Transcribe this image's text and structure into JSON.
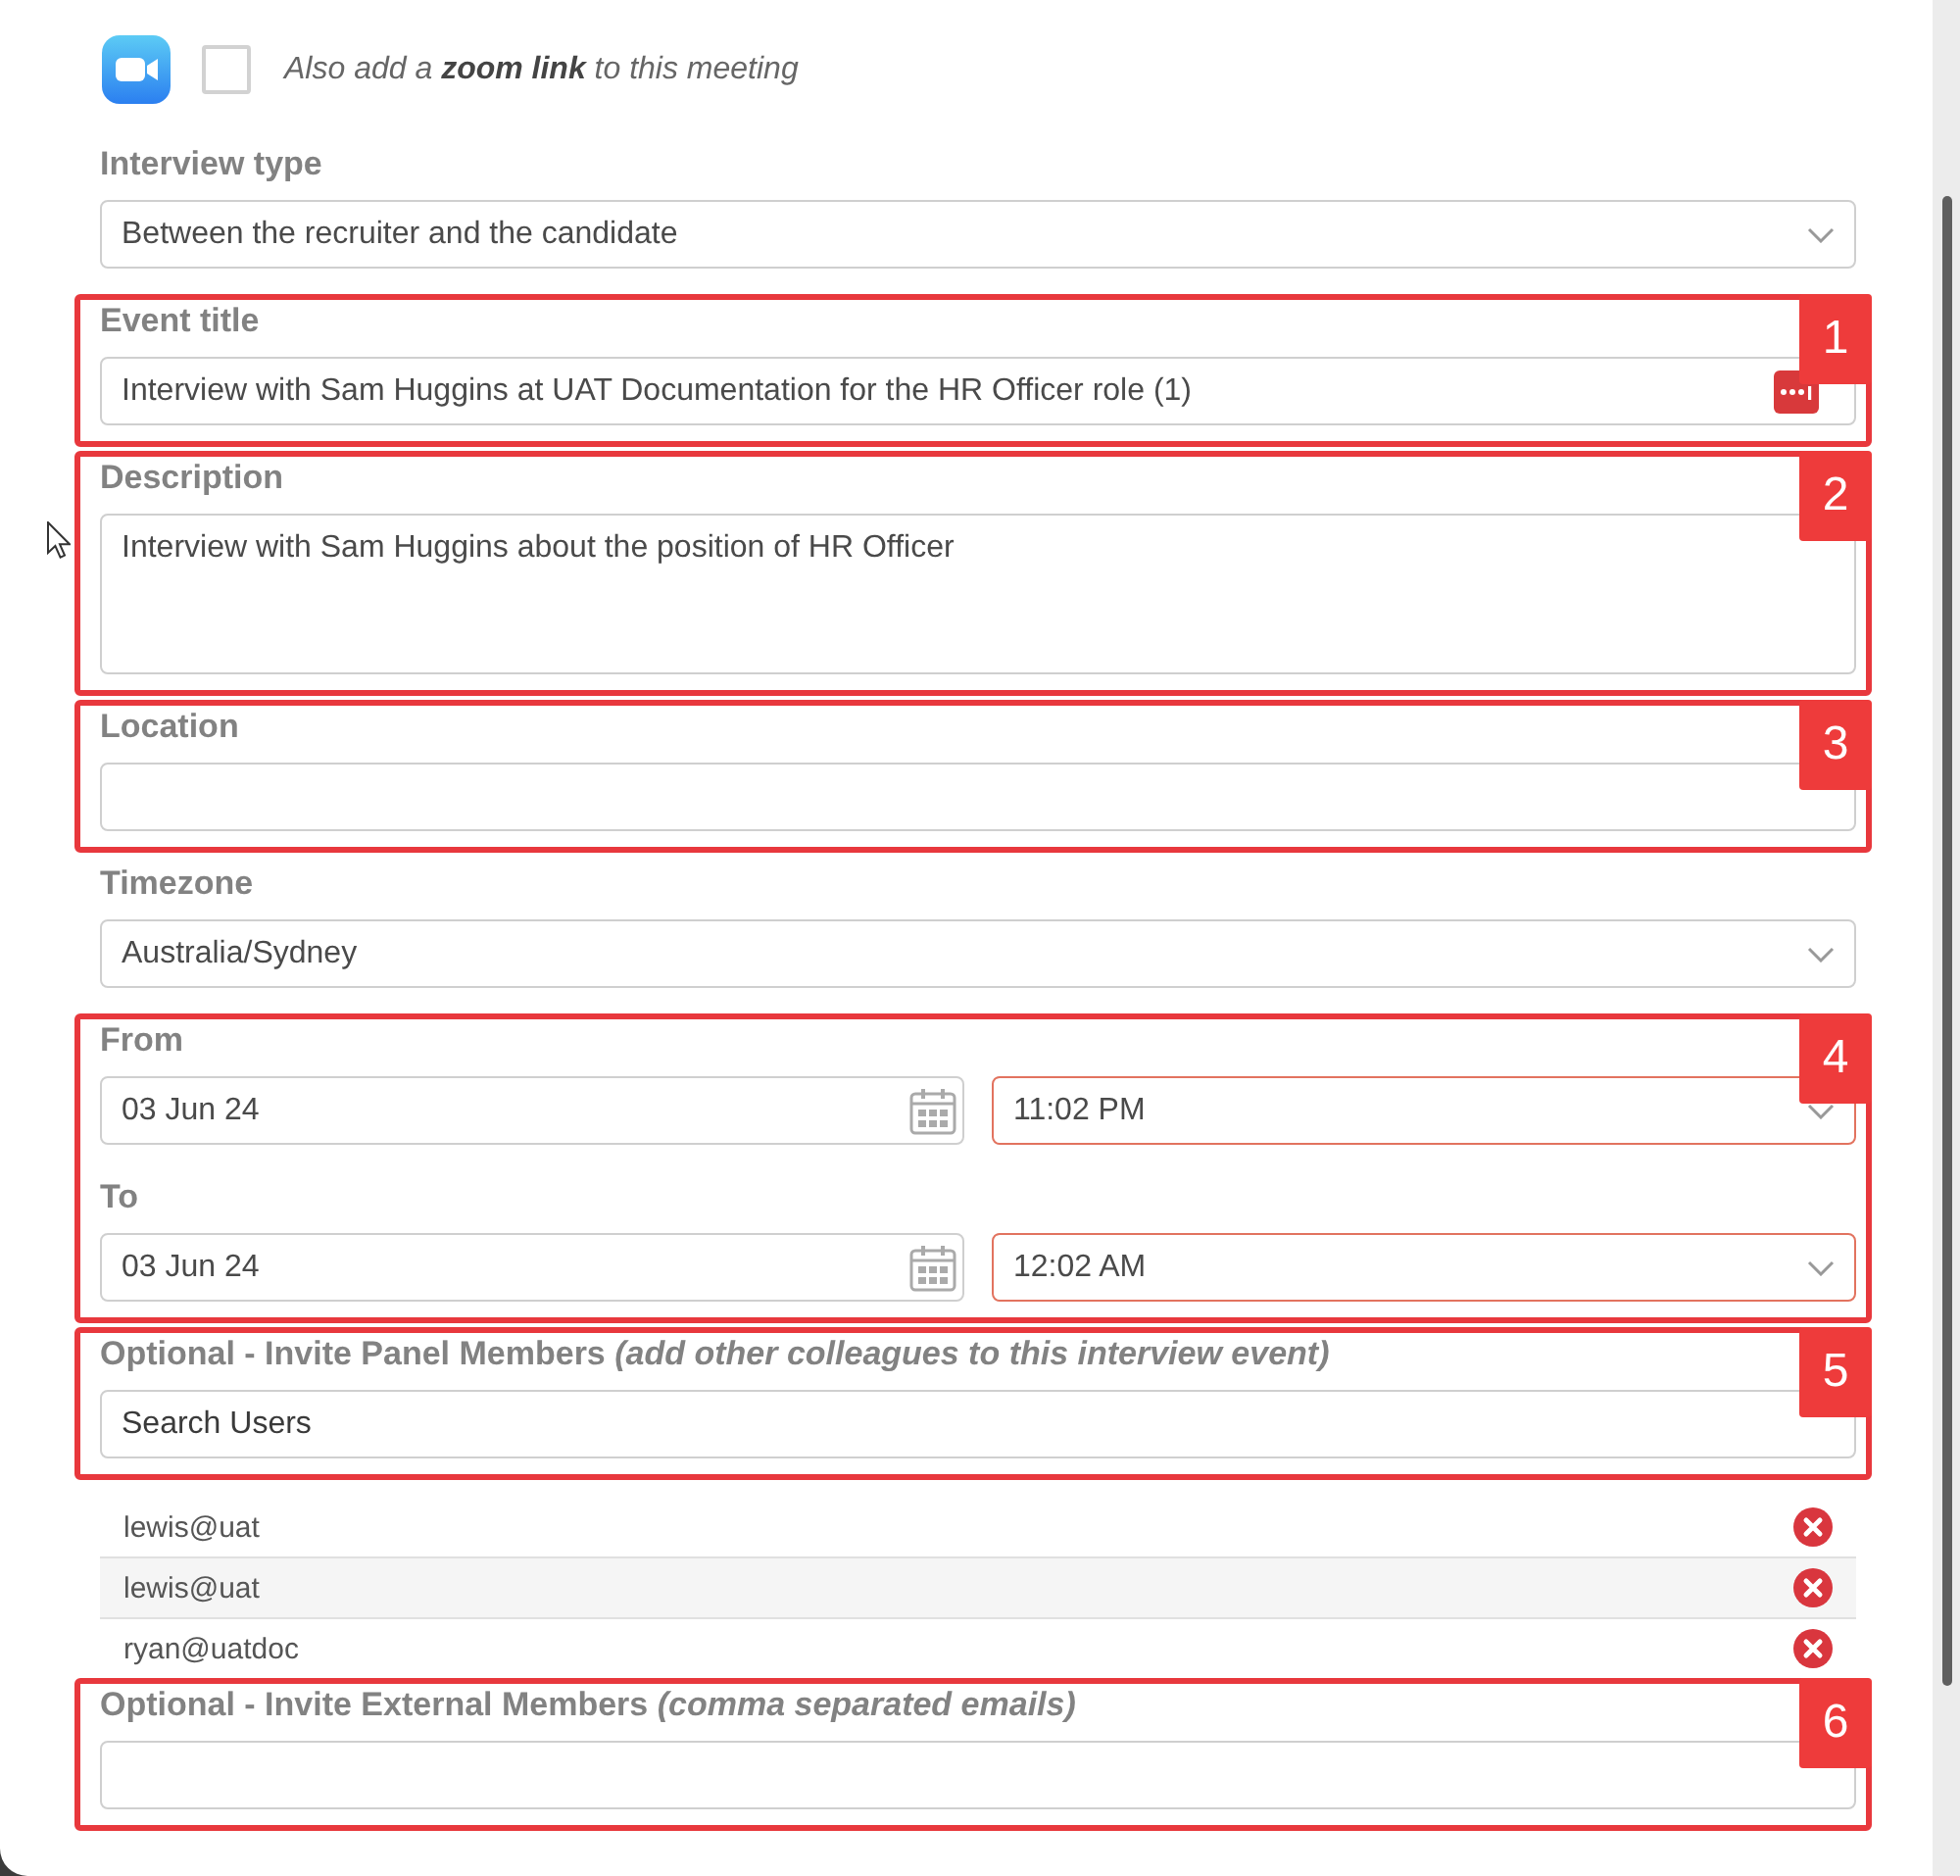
{
  "zoom_option": {
    "text": "Also add a **zoom link** to this meeting",
    "checked": false
  },
  "sections": [
    {
      "fields": [
        {
          "kind": "select",
          "label": "Interview type",
          "value": "Between the recruiter and the candidate"
        }
      ]
    },
    {
      "callout": "1",
      "fields": [
        {
          "kind": "text",
          "label": "Event title",
          "value": "Interview with Sam Huggins at UAT Documentation for the HR Officer role (1)",
          "menu_icon": true
        }
      ]
    },
    {
      "callout": "2",
      "fields": [
        {
          "kind": "textarea",
          "label": "Description",
          "value": "Interview with Sam Huggins about the position of HR Officer"
        }
      ]
    },
    {
      "callout": "3",
      "fields": [
        {
          "kind": "text",
          "label": "Location"
        }
      ]
    },
    {
      "fields": [
        {
          "kind": "select",
          "label": "Timezone",
          "value": "Australia/Sydney"
        }
      ]
    },
    {
      "callout": "4",
      "fields": [
        {
          "kind": "datetime",
          "label": "From",
          "date": "03 Jun 24",
          "time": "11:02 PM",
          "time_invalid": true
        },
        {
          "kind": "datetime",
          "label": "To",
          "date": "03 Jun 24",
          "time": "12:02 AM",
          "time_invalid": true
        }
      ]
    },
    {
      "callout": "5",
      "fields": [
        {
          "kind": "search",
          "label": "Optional - Invite Panel Members *(add other colleagues to this interview event)*",
          "placeholder": "Search Users"
        }
      ]
    },
    {
      "fields": [
        {
          "kind": "list",
          "items": [
            {
              "email": "lewis@uat"
            },
            {
              "email": "lewis@uat"
            },
            {
              "email": "ryan@uatdoc"
            }
          ]
        }
      ]
    },
    {
      "callout": "6",
      "fields": [
        {
          "kind": "text",
          "label": "Optional - Invite External Members *(comma separated emails)*"
        }
      ]
    }
  ]
}
